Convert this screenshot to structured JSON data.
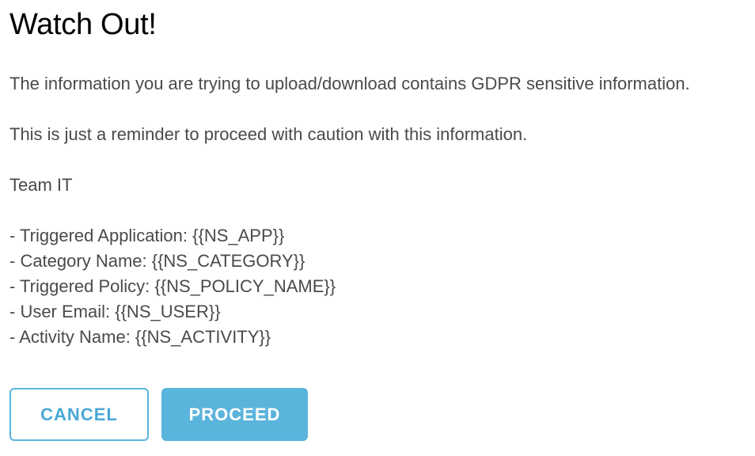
{
  "dialog": {
    "title": "Watch Out!",
    "paragraphs": [
      "The information you are trying to upload/download contains GDPR sensitive information.",
      "This is just a reminder to proceed with caution with this information.",
      "Team IT"
    ],
    "details": [
      "- Triggered Application: {{NS_APP}}",
      "- Category Name: {{NS_CATEGORY}}",
      "- Triggered Policy: {{NS_POLICY_NAME}}",
      "- User Email: {{NS_USER}}",
      "- Activity Name: {{NS_ACTIVITY}}"
    ]
  },
  "buttons": {
    "cancel_label": "CANCEL",
    "proceed_label": "PROCEED"
  },
  "colors": {
    "accent": "#5bb4dc",
    "title_text": "#000000",
    "body_text": "#4a4a4a",
    "background": "#ffffff"
  }
}
